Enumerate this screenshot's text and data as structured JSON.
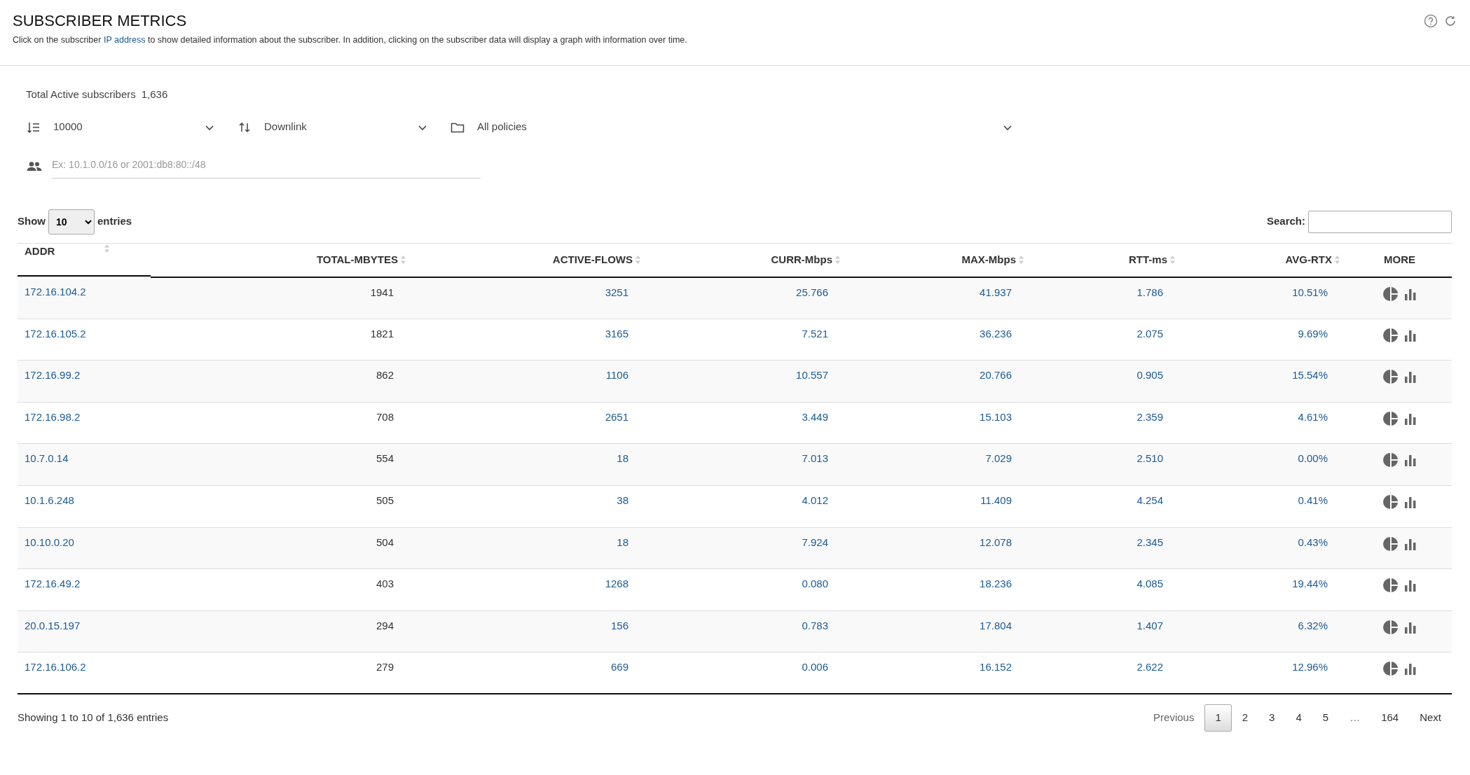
{
  "header": {
    "title": "SUBSCRIBER METRICS",
    "description": {
      "before": "Click on the subscriber ",
      "link": "IP address",
      "after": " to show detailed information about the subscriber. In addition, clicking on the subscriber data will display a graph with information over time."
    }
  },
  "summary": {
    "label": "Total Active subscribers",
    "value": "1,636"
  },
  "row_limit": {
    "value": "10000"
  },
  "direction": {
    "value": "Downlink"
  },
  "policy": {
    "value": "All policies"
  },
  "filter": {
    "placeholder": "Ex: 10.1.0.0/16 or 2001:db8:80::/48"
  },
  "table": {
    "length_menu": {
      "before": "Show",
      "value": "10",
      "after": "entries"
    },
    "search": {
      "label": "Search:"
    },
    "columns": [
      "ADDR",
      "TOTAL-MBYTES",
      "ACTIVE-FLOWS",
      "CURR-Mbps",
      "MAX-Mbps",
      "RTT-ms",
      "AVG-RTX",
      "MORE"
    ],
    "rows": [
      [
        "172.16.104.2",
        "1941",
        "3251",
        "25.766",
        "41.937",
        "1.786",
        "10.51%"
      ],
      [
        "172.16.105.2",
        "1821",
        "3165",
        "7.521",
        "36.236",
        "2.075",
        "9.69%"
      ],
      [
        "172.16.99.2",
        "862",
        "1106",
        "10.557",
        "20.766",
        "0.905",
        "15.54%"
      ],
      [
        "172.16.98.2",
        "708",
        "2651",
        "3.449",
        "15.103",
        "2.359",
        "4.61%"
      ],
      [
        "10.7.0.14",
        "554",
        "18",
        "7.013",
        "7.029",
        "2.510",
        "0.00%"
      ],
      [
        "10.1.6.248",
        "505",
        "38",
        "4.012",
        "11.409",
        "4.254",
        "0.41%"
      ],
      [
        "10.10.0.20",
        "504",
        "18",
        "7.924",
        "12.078",
        "2.345",
        "0.43%"
      ],
      [
        "172.16.49.2",
        "403",
        "1268",
        "0.080",
        "18.236",
        "4.085",
        "19.44%"
      ],
      [
        "20.0.15.197",
        "294",
        "156",
        "0.783",
        "17.804",
        "1.407",
        "6.32%"
      ],
      [
        "172.16.106.2",
        "279",
        "669",
        "0.006",
        "16.152",
        "2.622",
        "12.96%"
      ]
    ],
    "info": "Showing 1 to 10 of 1,636 entries",
    "pagination": [
      {
        "label": "Previous",
        "selected": false,
        "disabled": true
      },
      {
        "label": "1",
        "selected": true,
        "disabled": false
      },
      {
        "label": "2",
        "selected": false,
        "disabled": false
      },
      {
        "label": "3",
        "selected": false,
        "disabled": false
      },
      {
        "label": "4",
        "selected": false,
        "disabled": false
      },
      {
        "label": "5",
        "selected": false,
        "disabled": false
      },
      {
        "label": "…",
        "selected": false,
        "disabled": true
      },
      {
        "label": "164",
        "selected": false,
        "disabled": false
      },
      {
        "label": "Next",
        "selected": false,
        "disabled": false
      }
    ]
  }
}
